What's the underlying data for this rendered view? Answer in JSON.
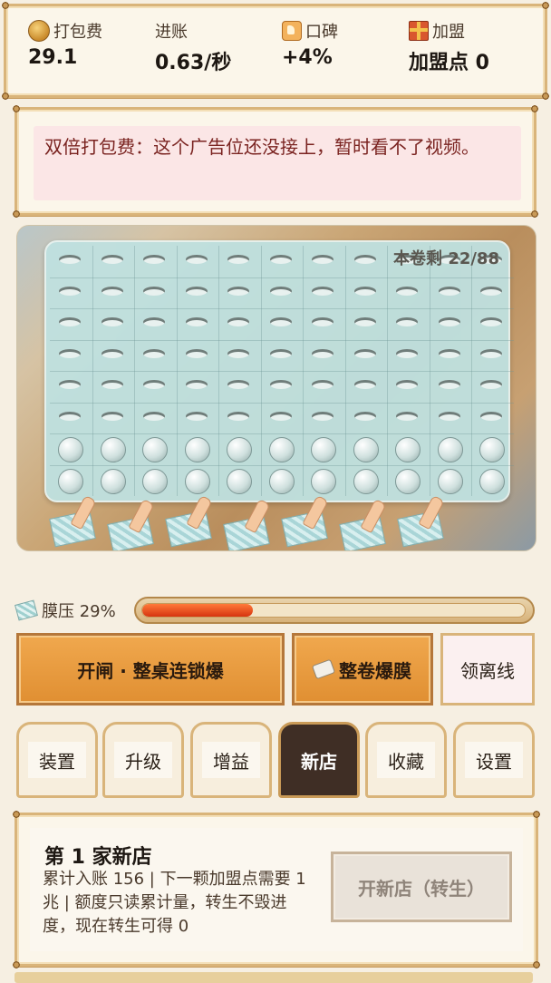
{
  "stats": [
    {
      "label": "打包费",
      "value": "29.1",
      "icon": "coin-stack-icon"
    },
    {
      "label": "进账",
      "value": "0.63/秒",
      "icon": ""
    },
    {
      "label": "口碑",
      "value": "+4%",
      "icon": "thumbs-up-icon"
    },
    {
      "label": "加盟",
      "value": "加盟点 0",
      "icon": "gift-box-icon"
    }
  ],
  "banner": {
    "text": "双倍打包费：这个广告位还没接上，暂时看不了视频。"
  },
  "board": {
    "remaining_text": "本卷剩 22/88",
    "remaining": 22,
    "total": 88,
    "columns": 11,
    "rows": 8
  },
  "pressure": {
    "label": "膜压 29%",
    "value": 0.29
  },
  "actions": {
    "chain_label": "开闸 · 整桌连锁爆",
    "roll_label": "整卷爆膜",
    "leave_label": "领离线"
  },
  "tabs": [
    {
      "label": "装置",
      "active": false
    },
    {
      "label": "升级",
      "active": false
    },
    {
      "label": "增益",
      "active": false
    },
    {
      "label": "新店",
      "active": true
    },
    {
      "label": "收藏",
      "active": false
    },
    {
      "label": "设置",
      "active": false
    }
  ],
  "shop": {
    "title": "第 1 家新店",
    "description": "累计入账 156 | 下一颗加盟点需要 1兆 | 额度只读累计量，转生不毁进度，现在转生可得 0",
    "button_label": "开新店（转生）"
  }
}
